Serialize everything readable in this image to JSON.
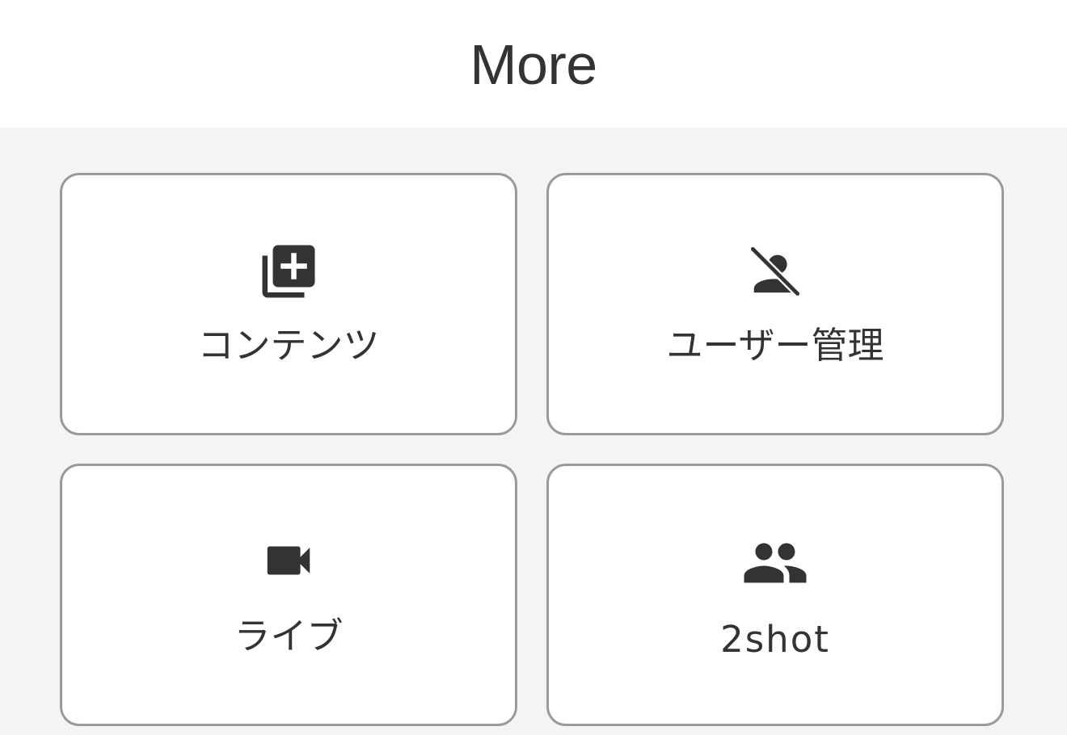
{
  "header": {
    "title": "More"
  },
  "menu": {
    "items": [
      {
        "label": "コンテンツ",
        "icon": "library-add-icon"
      },
      {
        "label": "ユーザー管理",
        "icon": "person-off-icon"
      },
      {
        "label": "ライブ",
        "icon": "videocam-icon"
      },
      {
        "label": "2shot",
        "icon": "group-icon"
      }
    ]
  },
  "colors": {
    "page_background": "#f4f4f4",
    "card_background": "#ffffff",
    "card_border": "#9a9a9a",
    "text": "#333333"
  }
}
